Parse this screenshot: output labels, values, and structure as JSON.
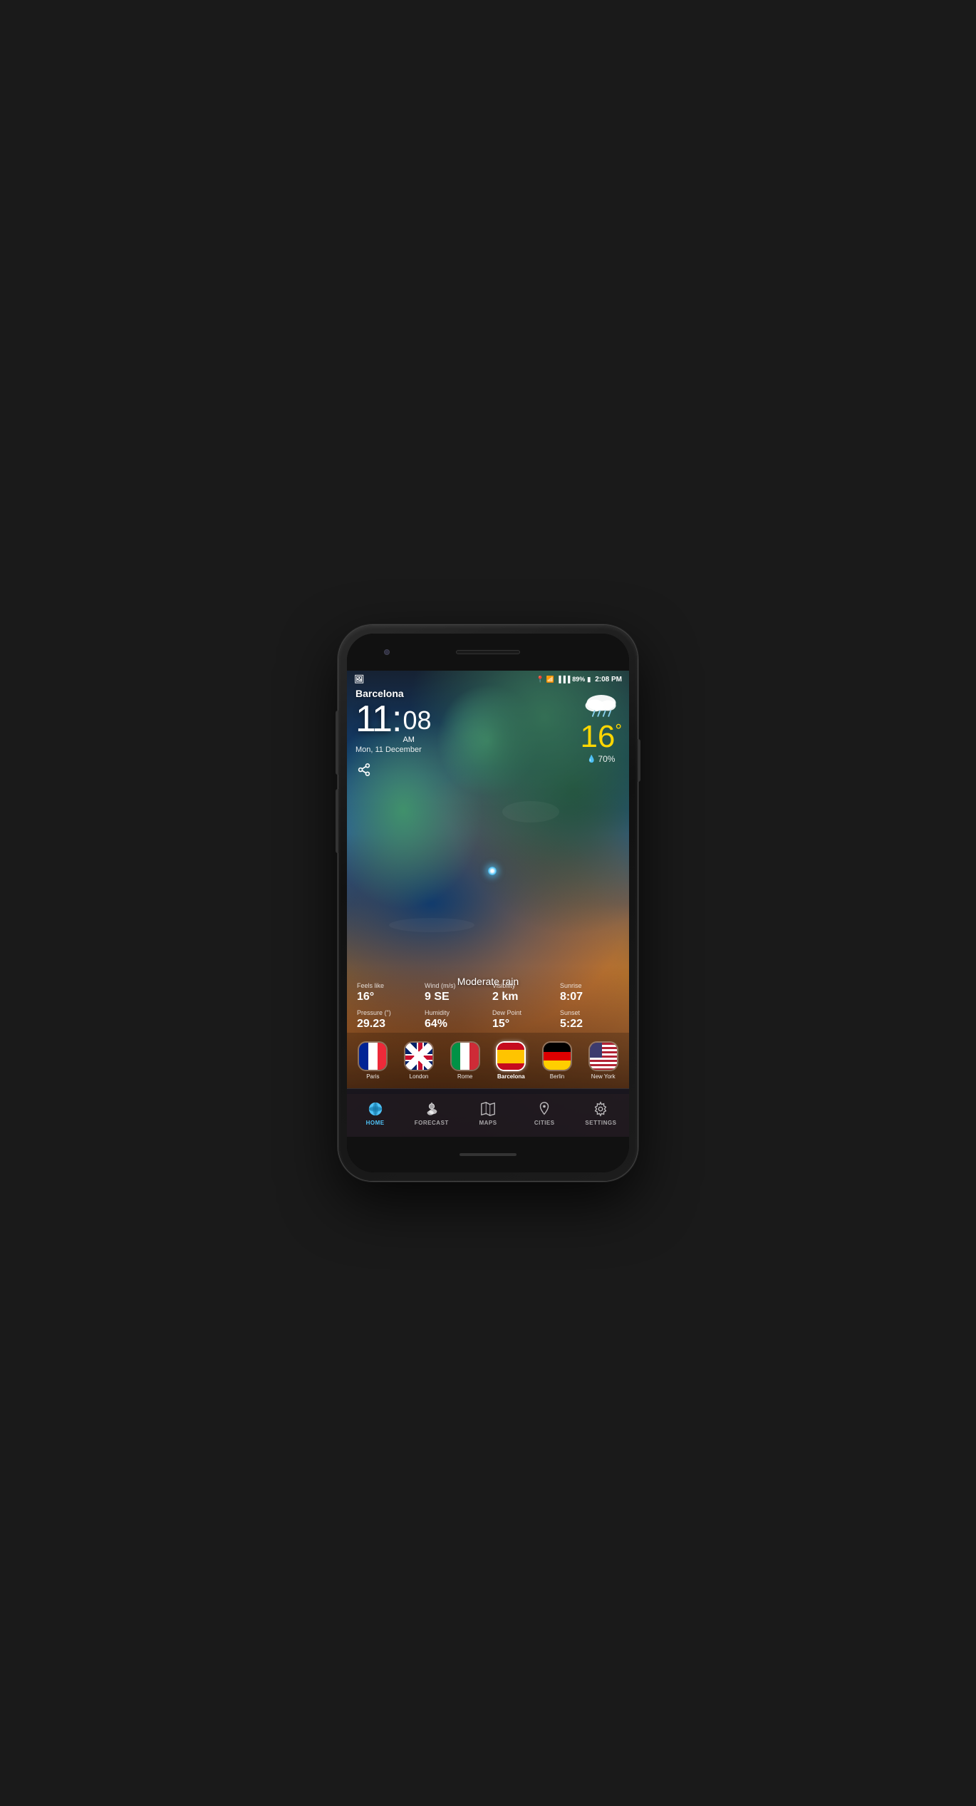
{
  "phone": {
    "status_bar": {
      "battery": "89%",
      "time": "2:08 PM",
      "signal_icon": "📶",
      "wifi_icon": "📡",
      "battery_icon": "🔋"
    },
    "weather": {
      "city": "Barcelona",
      "time_hour": "11",
      "time_minutes": "08",
      "time_ampm": "AM",
      "date": "Mon, 11 December",
      "temperature": "16",
      "temp_unit": "°",
      "humidity": "70%",
      "condition": "Moderate rain",
      "feels_like_label": "Feels like",
      "feels_like_value": "16°",
      "wind_label": "Wind (m/s)",
      "wind_value": "9 SE",
      "visibility_label": "Visibility",
      "visibility_value": "2 km",
      "sunrise_label": "Sunrise",
      "sunrise_value": "8:07",
      "pressure_label": "Pressure (\")",
      "pressure_value": "29.23",
      "humidity_label": "Humidity",
      "humidity_value": "64%",
      "dew_point_label": "Dew Point",
      "dew_point_value": "15°",
      "sunset_label": "Sunset",
      "sunset_value": "5:22"
    },
    "cities": [
      {
        "id": "paris",
        "name": "Paris",
        "selected": false,
        "flag": "fr"
      },
      {
        "id": "london",
        "name": "London",
        "selected": false,
        "flag": "uk"
      },
      {
        "id": "rome",
        "name": "Rome",
        "selected": false,
        "flag": "it"
      },
      {
        "id": "barcelona",
        "name": "Barcelona",
        "selected": true,
        "flag": "es"
      },
      {
        "id": "berlin",
        "name": "Berlin",
        "selected": false,
        "flag": "de"
      },
      {
        "id": "new-york",
        "name": "New York",
        "selected": false,
        "flag": "us"
      }
    ],
    "nav": [
      {
        "id": "home",
        "label": "HOME",
        "icon": "🌍",
        "active": true
      },
      {
        "id": "forecast",
        "label": "FORECAST",
        "icon": "⛅",
        "active": false
      },
      {
        "id": "maps",
        "label": "MAPS",
        "icon": "🗺",
        "active": false
      },
      {
        "id": "cities",
        "label": "CITIES",
        "icon": "📍",
        "active": false
      },
      {
        "id": "settings",
        "label": "SETTINGS",
        "icon": "⚙",
        "active": false
      }
    ]
  }
}
